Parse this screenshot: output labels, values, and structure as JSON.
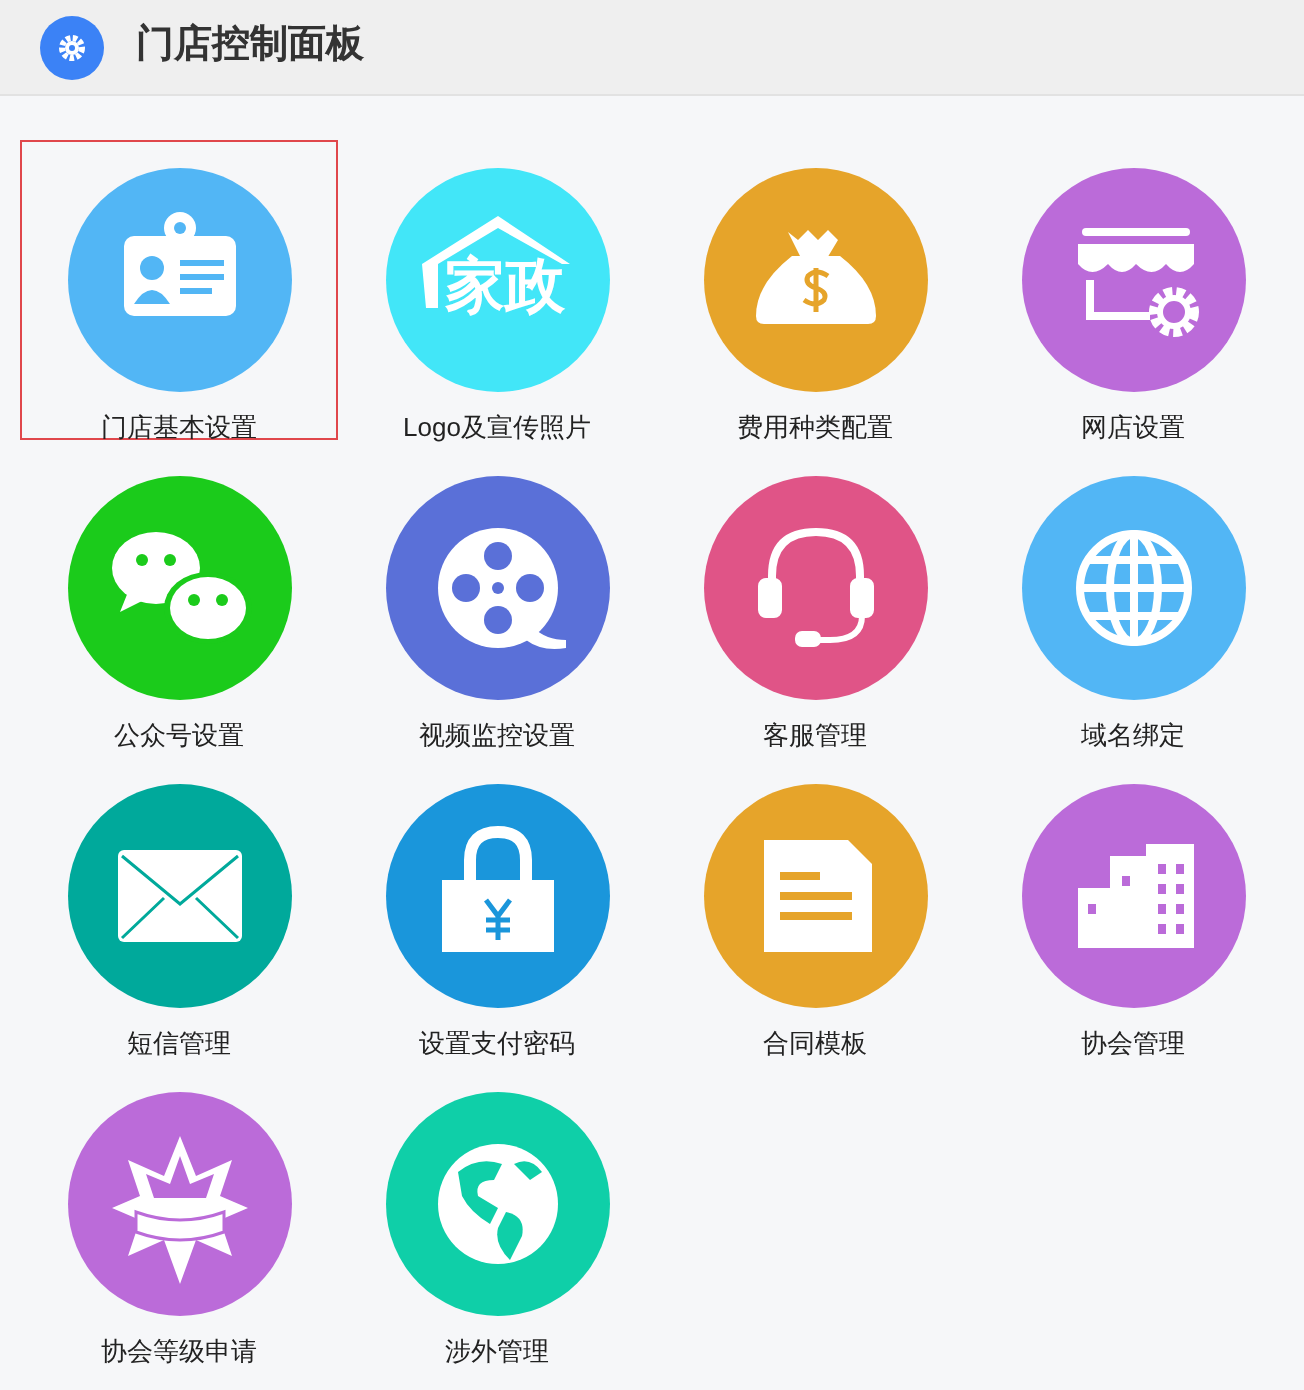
{
  "header": {
    "title": "门店控制面板"
  },
  "tiles": [
    {
      "label": "门店基本设置",
      "kind": "idcard",
      "color": "#52b6f5",
      "selected": true
    },
    {
      "label": "Logo及宣传照片",
      "kind": "logo",
      "color": "#42e6f8",
      "icon_text": "家政",
      "selected": false
    },
    {
      "label": "费用种类配置",
      "kind": "moneybag",
      "color": "#e6a42a",
      "selected": false
    },
    {
      "label": "网店设置",
      "kind": "shop",
      "color": "#bb6bd9",
      "selected": false
    },
    {
      "label": "公众号设置",
      "kind": "chat",
      "color": "#1bcb1b",
      "selected": false
    },
    {
      "label": "视频监控设置",
      "kind": "reel",
      "color": "#5a70d8",
      "selected": false
    },
    {
      "label": "客服管理",
      "kind": "headset",
      "color": "#e05487",
      "selected": false
    },
    {
      "label": "域名绑定",
      "kind": "globe",
      "color": "#52b6f5",
      "selected": false
    },
    {
      "label": "短信管理",
      "kind": "envelope",
      "color": "#00a99b",
      "selected": false
    },
    {
      "label": "设置支付密码",
      "kind": "lock",
      "color": "#1a96db",
      "selected": false
    },
    {
      "label": "合同模板",
      "kind": "document",
      "color": "#e6a42a",
      "selected": false
    },
    {
      "label": "协会管理",
      "kind": "buildings",
      "color": "#bb6bd9",
      "selected": false
    },
    {
      "label": "协会等级申请",
      "kind": "star",
      "color": "#bb6bd9",
      "selected": false
    },
    {
      "label": "涉外管理",
      "kind": "earth",
      "color": "#0fcfa8",
      "selected": false
    }
  ]
}
